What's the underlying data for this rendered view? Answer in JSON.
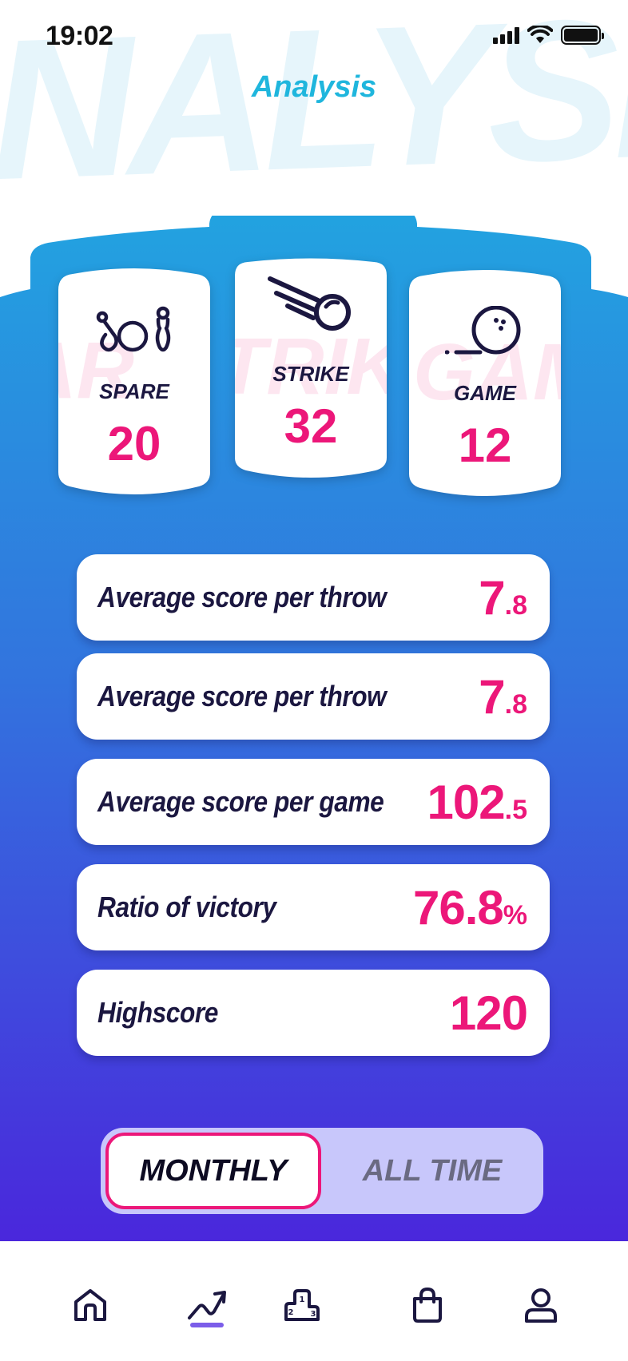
{
  "status": {
    "time": "19:02"
  },
  "header": {
    "title": "Analysis",
    "background_word": "ANALYSIS",
    "card_watermark": "PARTRIKGAME"
  },
  "stats": [
    {
      "label": "SPARE",
      "value": "20",
      "icon": "bowling-pins-icon"
    },
    {
      "label": "STRIKE",
      "value": "32",
      "icon": "strike-ball-icon"
    },
    {
      "label": "GAME",
      "value": "12",
      "icon": "rolling-ball-icon"
    }
  ],
  "metrics": [
    {
      "label": "Average score per throw",
      "value_main": "7",
      "value_sub": ".8"
    },
    {
      "label": "Average score per throw",
      "value_main": "7",
      "value_sub": ".8"
    },
    {
      "label": "Average score per game",
      "value_main": "102",
      "value_sub": ".5"
    },
    {
      "label": "Ratio of victory",
      "value_main": "76.8",
      "value_sub": "%"
    },
    {
      "label": "Highscore",
      "value_main": "120",
      "value_sub": ""
    }
  ],
  "period_toggle": {
    "options": [
      "MONTHLY",
      "ALL TIME"
    ],
    "selected": "MONTHLY"
  },
  "tabbar": {
    "items": [
      "home-icon",
      "analytics-icon",
      "leaderboard-icon",
      "shop-icon",
      "profile-icon"
    ],
    "active": "analytics-icon"
  },
  "colors": {
    "accent": "#ec1779",
    "title": "#1fb6dd",
    "gradient_top": "#23a3e0",
    "gradient_bottom": "#4a27dc",
    "ink": "#1b1740"
  }
}
